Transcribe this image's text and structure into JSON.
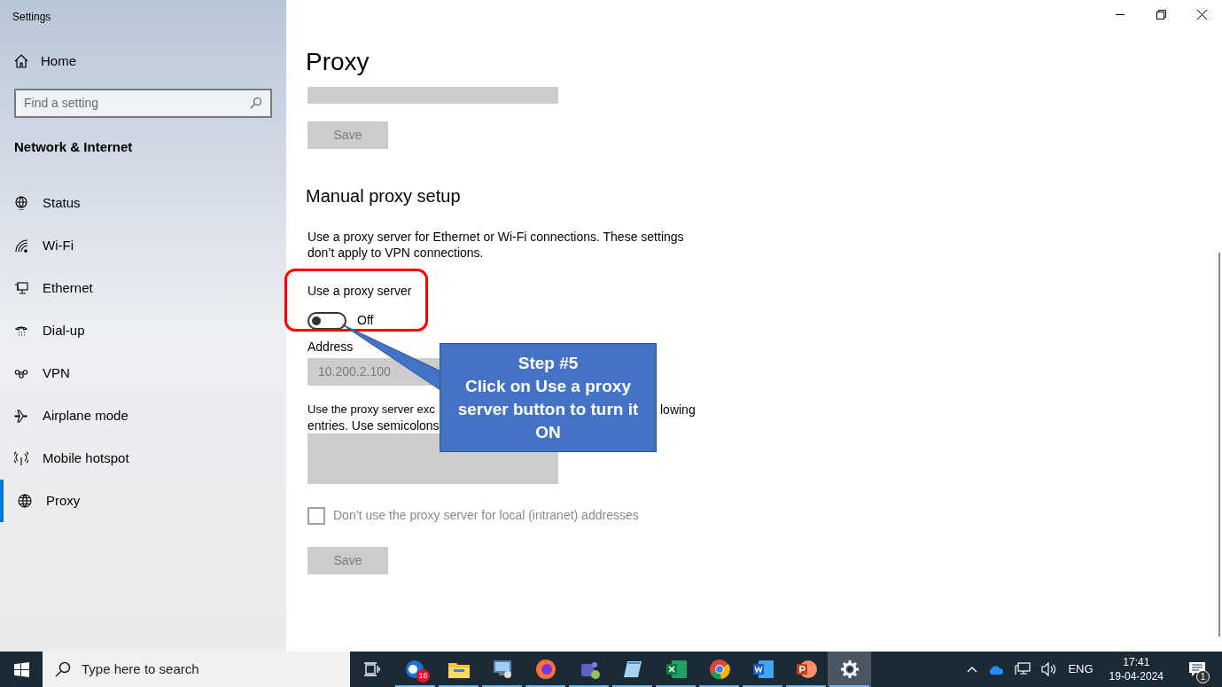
{
  "window": {
    "title": "Settings"
  },
  "sidebar": {
    "home": "Home",
    "search": {
      "placeholder": "Find a setting"
    },
    "section": "Network & Internet",
    "items": [
      {
        "label": "Status",
        "kind": "status",
        "selected": false
      },
      {
        "label": "Wi-Fi",
        "kind": "wifi",
        "selected": false
      },
      {
        "label": "Ethernet",
        "kind": "ethernet",
        "selected": false
      },
      {
        "label": "Dial-up",
        "kind": "dialup",
        "selected": false
      },
      {
        "label": "VPN",
        "kind": "vpn",
        "selected": false
      },
      {
        "label": "Airplane mode",
        "kind": "airplane",
        "selected": false
      },
      {
        "label": "Mobile hotspot",
        "kind": "hotspot",
        "selected": false
      },
      {
        "label": "Proxy",
        "kind": "proxy",
        "selected": true
      }
    ]
  },
  "page": {
    "title": "Proxy",
    "top_save": "Save",
    "manual": {
      "heading": "Manual proxy setup",
      "description": "Use a proxy server for Ethernet or Wi-Fi connections. These settings don’t apply to VPN connections.",
      "toggle": {
        "label": "Use a proxy server",
        "on": false,
        "state_text": "Off"
      },
      "address": {
        "label": "Address",
        "value": "10.200.2.100"
      },
      "exceptions": {
        "line_1": "Use the proxy server exc",
        "line_1_end": "lowing",
        "line_2": "entries. Use semicolons"
      },
      "local_checkbox": {
        "label": "Don’t use the proxy server for local (intranet) addresses",
        "checked": false
      },
      "save": "Save"
    }
  },
  "callout": {
    "title": "Step #5",
    "text": "Click on Use a proxy server button to turn it ON"
  },
  "taskbar": {
    "search": {
      "placeholder": "Type here to search"
    },
    "apps": [
      {
        "kind": "taskview",
        "running": false,
        "selected": false
      },
      {
        "kind": "mail",
        "running": true,
        "selected": false,
        "badge": "16"
      },
      {
        "kind": "folder",
        "running": true,
        "selected": false
      },
      {
        "kind": "remote",
        "running": true,
        "selected": false
      },
      {
        "kind": "firefox",
        "running": true,
        "selected": false
      },
      {
        "kind": "teams",
        "running": true,
        "selected": false
      },
      {
        "kind": "notepad",
        "running": true,
        "selected": false
      },
      {
        "kind": "excel",
        "running": true,
        "selected": false
      },
      {
        "kind": "chrome",
        "running": true,
        "selected": false
      },
      {
        "kind": "word",
        "running": true,
        "selected": false
      },
      {
        "kind": "powerpoint",
        "running": true,
        "selected": false
      },
      {
        "kind": "settings",
        "running": true,
        "selected": true
      }
    ],
    "tray": {
      "language": "ENG",
      "time": "17:41",
      "date": "19-04-2024",
      "notification_count": "1"
    }
  }
}
